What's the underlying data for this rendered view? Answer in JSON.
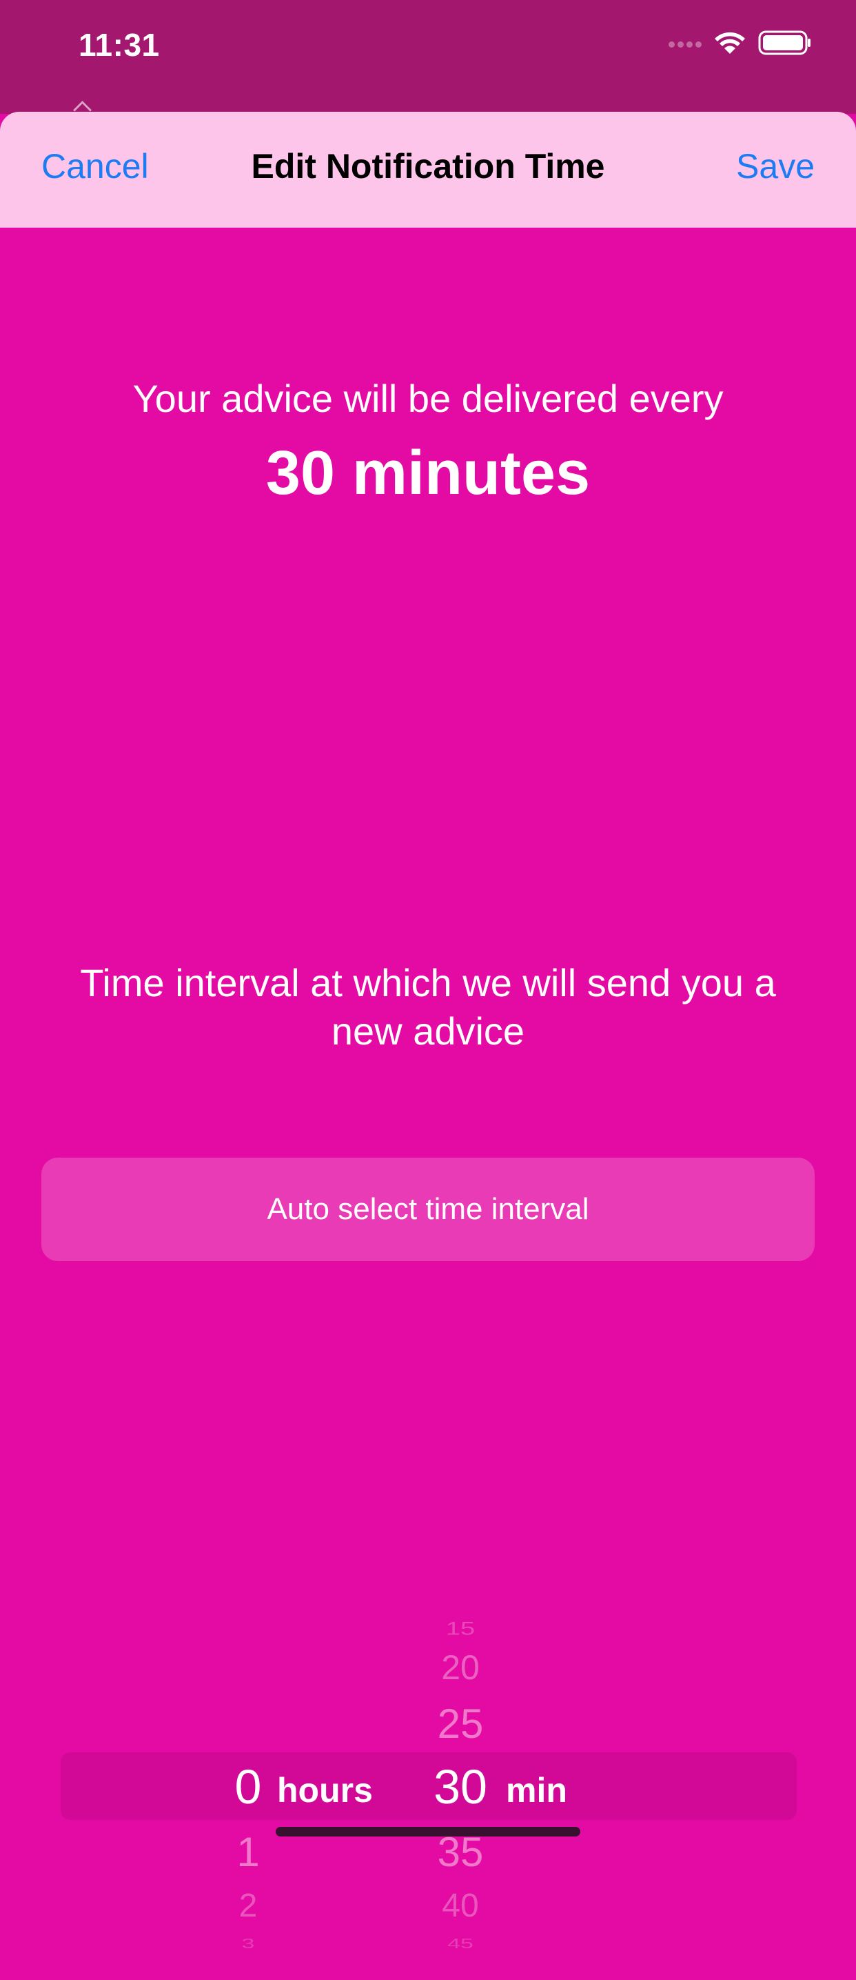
{
  "status_bar": {
    "time": "11:31"
  },
  "header": {
    "cancel": "Cancel",
    "title": "Edit Notification Time",
    "save": "Save"
  },
  "summary": {
    "lead": "Your advice will be delivered every",
    "value": "30 minutes"
  },
  "description": "Time interval at which we will send you a new advice",
  "auto_button": "Auto select time interval",
  "picker": {
    "hours": {
      "above": [],
      "selected": "0",
      "below": [
        "1",
        "2",
        "3"
      ],
      "unit": "hours"
    },
    "minutes": {
      "above": [
        "15",
        "20",
        "25"
      ],
      "selected": "30",
      "below": [
        "35",
        "40",
        "45"
      ],
      "unit": "min"
    }
  },
  "colors": {
    "background": "#e30ba3",
    "header": "#fec5ea",
    "accent": "#1d7cf2"
  },
  "icons": [
    "wifi-icon",
    "battery-icon",
    "signal-dots-icon"
  ]
}
